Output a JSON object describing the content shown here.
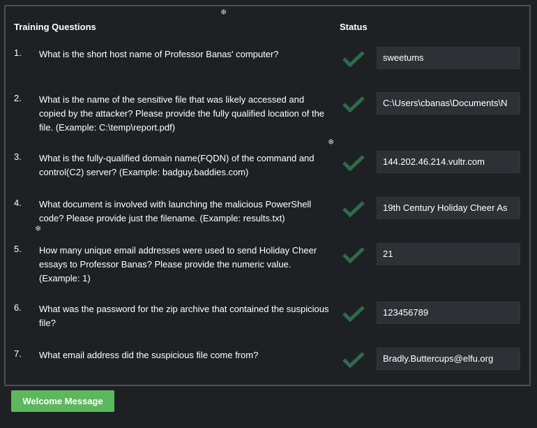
{
  "header": {
    "questions_label": "Training Questions",
    "status_label": "Status"
  },
  "questions": [
    {
      "number": "1.",
      "text": "What is the short host name of Professor Banas' computer?",
      "answer": "sweetums",
      "status": "check-icon"
    },
    {
      "number": "2.",
      "text": "What is the name of the sensitive file that was likely accessed and copied by the attacker? Please provide the fully qualified location of the file. (Example: C:\\temp\\report.pdf)",
      "answer": "C:\\Users\\cbanas\\Documents\\N",
      "status": "check-icon"
    },
    {
      "number": "3.",
      "text": "What is the fully-qualified domain name(FQDN) of the command and control(C2) server? (Example: badguy.baddies.com)",
      "answer": "144.202.46.214.vultr.com",
      "status": "check-icon"
    },
    {
      "number": "4.",
      "text": "What document is involved with launching the malicious PowerShell code? Please provide just the filename. (Example: results.txt)",
      "answer": "19th Century Holiday Cheer As",
      "status": "check-icon"
    },
    {
      "number": "5.",
      "text": "How many unique email addresses were used to send Holiday Cheer essays to Professor Banas? Please provide the numeric value. (Example: 1)",
      "answer": "21",
      "status": "check-icon"
    },
    {
      "number": "6.",
      "text": "What was the password for the zip archive that contained the suspicious file?",
      "answer": "123456789",
      "status": "check-icon"
    },
    {
      "number": "7.",
      "text": "What email address did the suspicious file come from?",
      "answer": "Bradly.Buttercups@elfu.org",
      "status": "check-icon"
    }
  ],
  "welcome_button": {
    "label": "Welcome Message"
  },
  "colors": {
    "background": "#1e2124",
    "answer_bg": "#2d3136",
    "check": "#2e6b4a",
    "button": "#5cb85c"
  }
}
